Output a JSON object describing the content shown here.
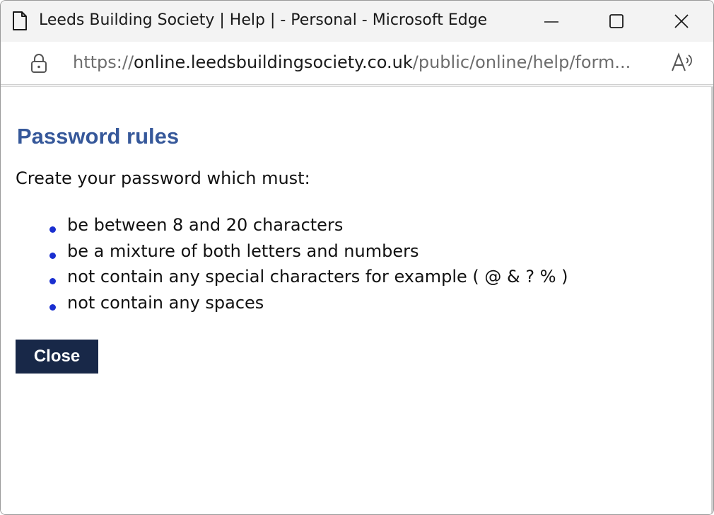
{
  "window": {
    "title": "Leeds Building Society | Help | - Personal - Microsoft Edge"
  },
  "address_bar": {
    "url_scheme": "https://",
    "url_host": "online.leedsbuildingsociety.co.uk",
    "url_path": "/public/online/help/form..."
  },
  "page": {
    "heading": "Password rules",
    "intro": "Create your password which must:",
    "rules": [
      "be between 8 and 20 characters",
      "be a mixture of both letters and numbers",
      "not contain any special characters for example ( @ & ? % )",
      "not contain any spaces"
    ],
    "close_label": "Close"
  },
  "colors": {
    "heading": "#36589a",
    "bullet": "#1a2fd0",
    "close_button_bg": "#182848",
    "close_button_text": "#ffffff",
    "titlebar_bg": "#f3f3f3"
  },
  "icons": {
    "tab": "page-icon",
    "lock": "lock-icon",
    "read_aloud": "read-aloud-icon",
    "minimize": "minimize-icon",
    "maximize": "maximize-icon",
    "close": "close-icon"
  }
}
